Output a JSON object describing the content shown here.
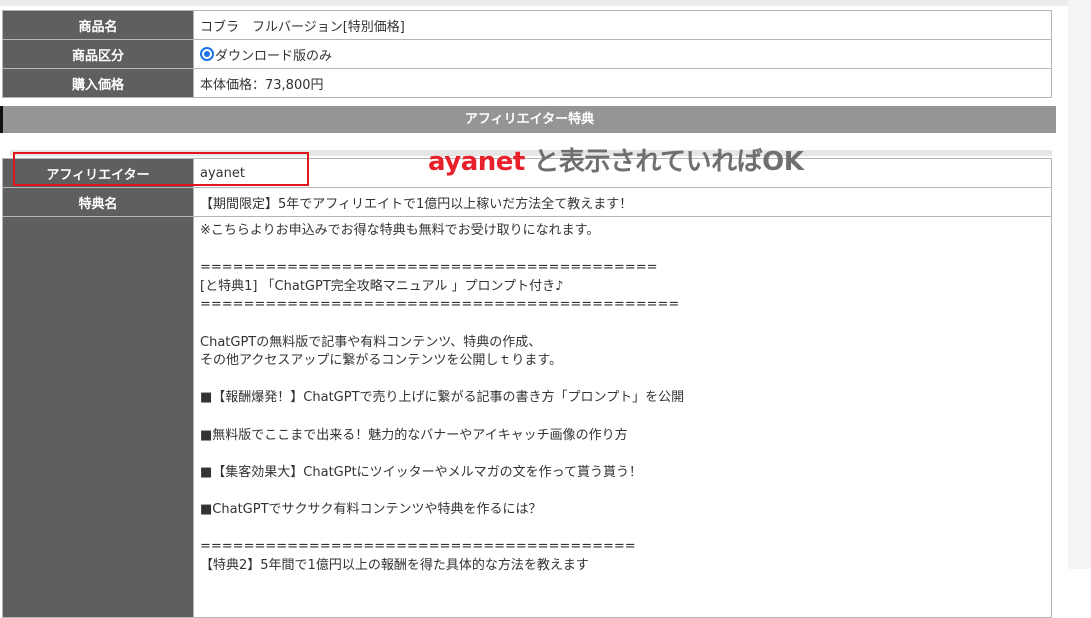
{
  "product": {
    "name_label": "商品名",
    "name_value": "コブラ　フルバージョン[特別価格]",
    "type_label": "商品区分",
    "type_value": "ダウンロード版のみ",
    "price_label": "購入価格",
    "price_value": "本体価格：73,800円"
  },
  "section_title": "アフィリエイター特典",
  "affiliate": {
    "label": "アフィリエイター",
    "value": "ayanet",
    "bonus_label": "特典名",
    "bonus_value": "【期間限定】5年でアフィリエイトで1億円以上稼いだ方法全て教えます！"
  },
  "annotation": {
    "highlight": "ayanet",
    "rest": "と表示されていればOK"
  },
  "body_lines": [
    "※こちらよりお申込みでお得な特典も無料でお受け取りになれます。",
    "",
    "==========================================",
    "[と特典1] 「ChatGPT完全攻略マニュアル 」プロンプト付き♪",
    "============================================",
    "",
    "ChatGPTの無料版で記事や有料コンテンツ、特典の作成、",
    "その他アクセスアップに繋がるコンテンツを公開しｔります。",
    "",
    "■【報酬爆発！】ChatGPTで売り上げに繋がる記事の書き方「プロンプト」を公開",
    "",
    "■無料版でここまで出来る！魅力的なバナーやアイキャッチ画像の作り方",
    "",
    "■【集客効果大】ChatGPtにツイッターやメルマガの文を作って貰う貰う！",
    "",
    "■ChatGPTでサクサク有料コンテンツや特典を作るには？",
    "",
    "========================================",
    "【特典2】5年間で1億円以上の報酬を得た具体的な方法を教えます"
  ]
}
